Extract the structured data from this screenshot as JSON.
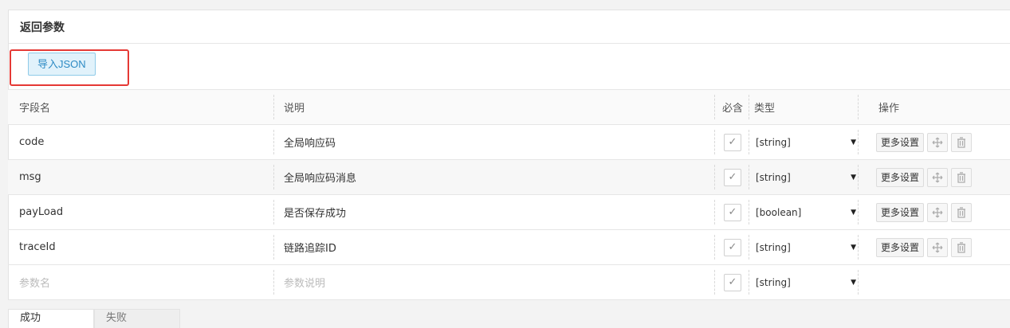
{
  "section": {
    "title": "返回参数"
  },
  "toolbar": {
    "import_label": "导入JSON"
  },
  "table": {
    "headers": {
      "field": "字段名",
      "desc": "说明",
      "required": "必含",
      "type": "类型",
      "ops": "操作"
    },
    "rows": [
      {
        "field": "code",
        "desc": "全局响应码",
        "required": true,
        "type": "[string]"
      },
      {
        "field": "msg",
        "desc": "全局响应码消息",
        "required": true,
        "type": "[string]"
      },
      {
        "field": "payLoad",
        "desc": "是否保存成功",
        "required": true,
        "type": "[boolean]"
      },
      {
        "field": "traceId",
        "desc": "链路追踪ID",
        "required": true,
        "type": "[string]"
      }
    ],
    "new_row": {
      "field_placeholder": "参数名",
      "desc_placeholder": "参数说明",
      "type": "[string]"
    },
    "more_settings_label": "更多设置",
    "check_glyph": "✓"
  },
  "tabs": [
    "成功",
    "失败"
  ]
}
